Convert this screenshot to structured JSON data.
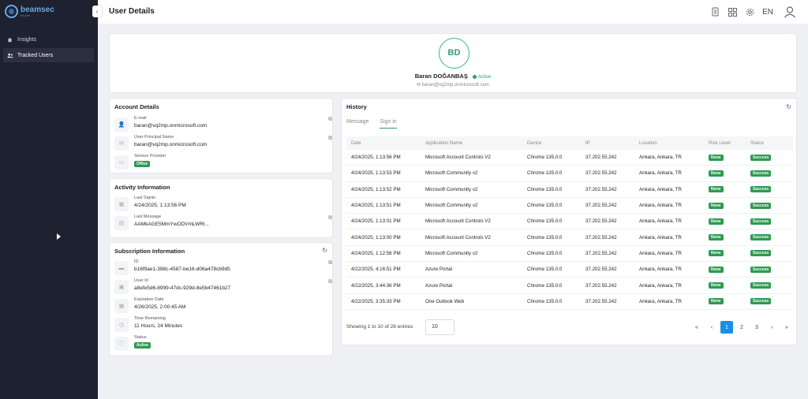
{
  "app": {
    "logo_text": "beamsec",
    "logo_sub": "team"
  },
  "sidebar": {
    "collapse_glyph": "‹",
    "items": [
      {
        "label": "Insights",
        "icon": "home-icon",
        "active": false
      },
      {
        "label": "Tracked Users",
        "icon": "users-icon",
        "active": true
      }
    ]
  },
  "header": {
    "title": "User Details",
    "language": "EN"
  },
  "profile": {
    "initials": "BD",
    "name": "Baran DOĞANBAŞ",
    "status": "Active",
    "email": "baran@vq2mp.onmicrosoft.com"
  },
  "account_details": {
    "title": "Account Details",
    "email_label": "E-mail",
    "email_value": "baran@vq2mp.onmicrosoft.com",
    "upn_label": "User Principal Name",
    "upn_value": "baran@vq2mp.onmicrosoft.com",
    "provider_label": "Service Provider",
    "provider_value": "Office"
  },
  "activity": {
    "title": "Activity Information",
    "last_signin_label": "Last Signin",
    "last_signin_value": "4/24/2025, 1:13:56 PM",
    "last_message_label": "Last Message",
    "last_message_value": "AAMkAGE5MmYwODVmLWRl..."
  },
  "subscription": {
    "title": "Subscription Information",
    "id_label": "ID",
    "id_value": "b16f9ae1-398c-4587-be16-d06a478cb9d5",
    "userid_label": "User Id",
    "userid_value": "a8efe5d6-8999-47dc-929d-8e5b47461b27",
    "expiration_label": "Expiration Date",
    "expiration_value": "4/26/2025, 2:00:45 AM",
    "remaining_label": "Time Remaining",
    "remaining_value": "11 Hours, 24 Minutes",
    "status_label": "Status",
    "status_value": "Active"
  },
  "history": {
    "title": "History",
    "tabs": [
      "Message",
      "Sign in"
    ],
    "active_tab": "Sign in",
    "columns": [
      "Date",
      "Application Name",
      "Device",
      "IP",
      "Location",
      "Risk Level",
      "Status"
    ],
    "rows": [
      {
        "date": "4/24/2025, 1:13:56 PM",
        "app": "Microsoft Account Controls V2",
        "device": "Chrome 135.0.0",
        "ip": "37.202.55.242",
        "location": "Ankara, Ankara, TR",
        "risk": "None",
        "status": "Success"
      },
      {
        "date": "4/24/2025, 1:13:53 PM",
        "app": "Microsoft Community v2",
        "device": "Chrome 135.0.0",
        "ip": "37.202.55.242",
        "location": "Ankara, Ankara, TR",
        "risk": "None",
        "status": "Success"
      },
      {
        "date": "4/24/2025, 1:13:52 PM",
        "app": "Microsoft Community v2",
        "device": "Chrome 135.0.0",
        "ip": "37.202.55.242",
        "location": "Ankara, Ankara, TR",
        "risk": "None",
        "status": "Success"
      },
      {
        "date": "4/24/2025, 1:13:51 PM",
        "app": "Microsoft Community v2",
        "device": "Chrome 135.0.0",
        "ip": "37.202.55.242",
        "location": "Ankara, Ankara, TR",
        "risk": "None",
        "status": "Success"
      },
      {
        "date": "4/24/2025, 1:13:01 PM",
        "app": "Microsoft Account Controls V2",
        "device": "Chrome 135.0.0",
        "ip": "37.202.55.242",
        "location": "Ankara, Ankara, TR",
        "risk": "None",
        "status": "Success"
      },
      {
        "date": "4/24/2025, 1:13:00 PM",
        "app": "Microsoft Account Controls V2",
        "device": "Chrome 135.0.0",
        "ip": "37.202.55.242",
        "location": "Ankara, Ankara, TR",
        "risk": "None",
        "status": "Success"
      },
      {
        "date": "4/24/2025, 1:12:56 PM",
        "app": "Microsoft Community v2",
        "device": "Chrome 135.0.0",
        "ip": "37.202.55.242",
        "location": "Ankara, Ankara, TR",
        "risk": "None",
        "status": "Success"
      },
      {
        "date": "4/22/2025, 4:16:51 PM",
        "app": "Azure Portal",
        "device": "Chrome 135.0.0",
        "ip": "37.202.55.242",
        "location": "Ankara, Ankara, TR",
        "risk": "None",
        "status": "Success"
      },
      {
        "date": "4/22/2025, 3:44:36 PM",
        "app": "Azure Portal",
        "device": "Chrome 135.0.0",
        "ip": "37.202.55.242",
        "location": "Ankara, Ankara, TR",
        "risk": "None",
        "status": "Success"
      },
      {
        "date": "4/22/2025, 3:35:33 PM",
        "app": "One Outlook Web",
        "device": "Chrome 135.0.0",
        "ip": "37.202.55.242",
        "location": "Ankara, Ankara, TR",
        "risk": "None",
        "status": "Success"
      }
    ],
    "entries_text": "Showing 1 to 10 of 28 entries",
    "page_size": "10",
    "pages": [
      "1",
      "2",
      "3"
    ],
    "current_page": "1"
  },
  "colors": {
    "sidebar_bg": "#1e2130",
    "accent_green": "#2e9a76",
    "pill_green": "#2e9a52",
    "page_active": "#1890e8"
  }
}
